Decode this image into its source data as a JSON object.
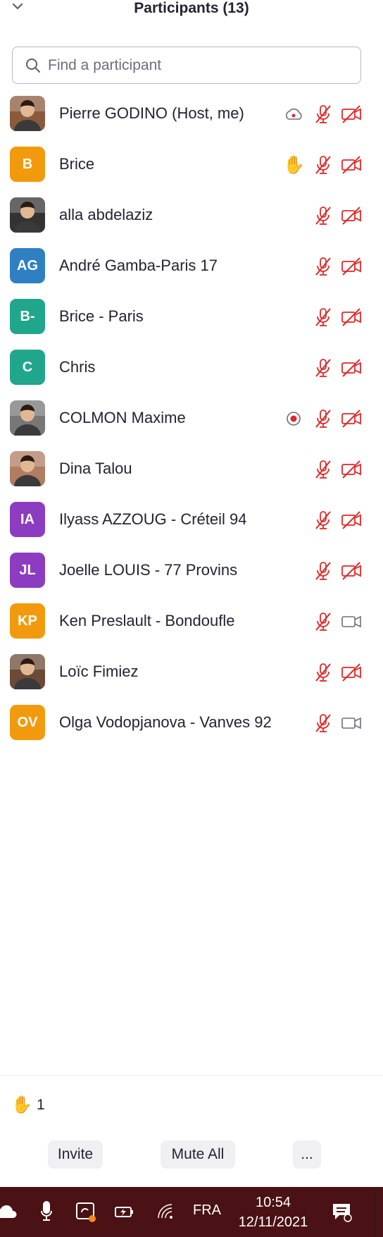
{
  "header": {
    "title": "Participants (13)",
    "collapse_icon": "chevron-down-icon"
  },
  "search": {
    "placeholder": "Find a participant",
    "value": ""
  },
  "colors": {
    "muted_red": "#e02828",
    "host_accent": "#0e72ed"
  },
  "participants": [
    {
      "name": "Pierre GODINO (Host, me)",
      "avatar": "photo",
      "initials": "",
      "color": "#8a5a3c",
      "extra_icon": "cloud-record-icon",
      "mic": "muted",
      "video": "off"
    },
    {
      "name": "Brice",
      "avatar": "initials",
      "initials": "B",
      "color": "#f29a0e",
      "extra_icon": "raised-hand-icon",
      "mic": "muted",
      "video": "off"
    },
    {
      "name": "alla abdelaziz",
      "avatar": "photo",
      "initials": "",
      "color": "#333333",
      "extra_icon": "",
      "mic": "muted",
      "video": "off"
    },
    {
      "name": "André Gamba-Paris 17",
      "avatar": "initials",
      "initials": "AG",
      "color": "#2f7fc3",
      "extra_icon": "",
      "mic": "muted",
      "video": "off"
    },
    {
      "name": "Brice - Paris",
      "avatar": "initials",
      "initials": "B-",
      "color": "#20a68b",
      "extra_icon": "",
      "mic": "muted",
      "video": "off"
    },
    {
      "name": "Chris",
      "avatar": "initials",
      "initials": "C",
      "color": "#20a68b",
      "extra_icon": "",
      "mic": "muted",
      "video": "off"
    },
    {
      "name": "COLMON Maxime",
      "avatar": "photo",
      "initials": "",
      "color": "#777777",
      "extra_icon": "recording-icon",
      "mic": "muted",
      "video": "off"
    },
    {
      "name": "Dina Talou",
      "avatar": "photo",
      "initials": "",
      "color": "#b07d62",
      "extra_icon": "",
      "mic": "muted",
      "video": "off"
    },
    {
      "name": "Ilyass AZZOUG - Créteil 94",
      "avatar": "initials",
      "initials": "IA",
      "color": "#8c3cc0",
      "extra_icon": "",
      "mic": "muted",
      "video": "off"
    },
    {
      "name": "Joelle LOUIS - 77 Provins",
      "avatar": "initials",
      "initials": "JL",
      "color": "#8c3cc0",
      "extra_icon": "",
      "mic": "muted",
      "video": "off"
    },
    {
      "name": "Ken Preslault - Bondoufle",
      "avatar": "initials",
      "initials": "KP",
      "color": "#f29a0e",
      "extra_icon": "",
      "mic": "muted",
      "video": "on"
    },
    {
      "name": "Loïc Fimiez",
      "avatar": "photo",
      "initials": "",
      "color": "#6b4a36",
      "extra_icon": "",
      "mic": "muted",
      "video": "off"
    },
    {
      "name": "Olga Vodopjanova - Vanves 92",
      "avatar": "initials",
      "initials": "OV",
      "color": "#f29a0e",
      "extra_icon": "",
      "mic": "muted",
      "video": "on"
    }
  ],
  "footer": {
    "raised_hand_icon": "raised-hand-icon",
    "raised_hand_count": "1",
    "invite_label": "Invite",
    "mute_all_label": "Mute All",
    "more_label": "..."
  },
  "taskbar": {
    "icons": [
      "onedrive-cloud-icon",
      "microphone-icon",
      "sync-icon",
      "battery-charging-icon",
      "wifi-icon",
      "notification-icon"
    ],
    "language": "FRA",
    "time": "10:54",
    "date": "12/11/2021"
  }
}
